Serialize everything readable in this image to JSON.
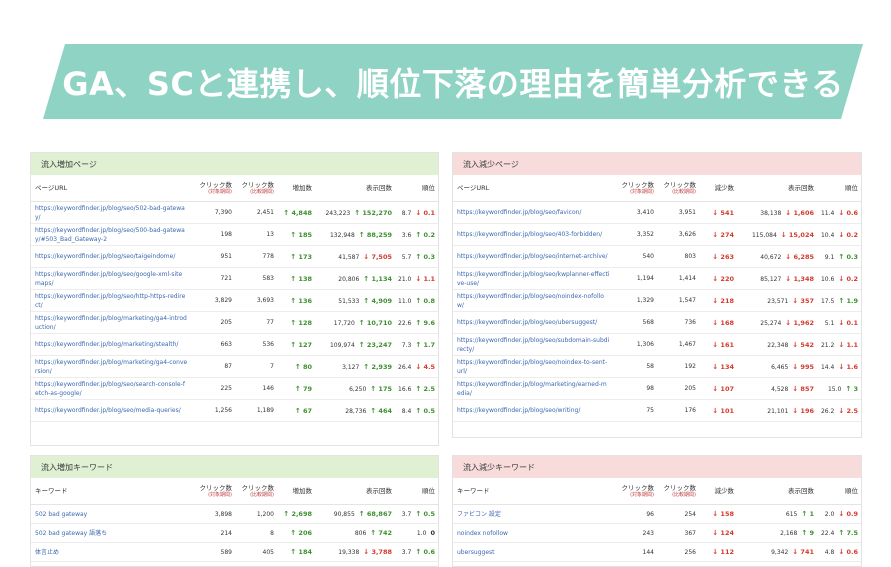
{
  "banner": {
    "title": "GA、SCと連携し、順位下落の理由を簡単分析できる",
    "color": "#8fd3c4"
  },
  "colors": {
    "up": "#3c8f2e",
    "down": "#d23a2e",
    "link": "#3b68b0"
  },
  "panels": {
    "increase_pages": {
      "title": "流入増加ページ",
      "headers": {
        "url": "ページURL",
        "click_curr": "クリック数",
        "click_curr_sub": "(対象期間)",
        "click_prev": "クリック数",
        "click_prev_sub": "(比較期間)",
        "delta": "増加数",
        "impr": "表示回数",
        "rank": "順位"
      },
      "rows": [
        {
          "url": "https://keywordfinder.jp/blog/seo/502-bad-gateway/",
          "c1": "7,390",
          "c2": "2,451",
          "d": "4,848",
          "dd": "up",
          "i": "243,223",
          "id": "152,270",
          "idd": "up",
          "r": "8.7",
          "rd": "0.1",
          "rdd": "down"
        },
        {
          "url": "https://keywordfinder.jp/blog/seo/500-bad-gateway/#503_Bad_Gateway-2",
          "c1": "198",
          "c2": "13",
          "d": "185",
          "dd": "up",
          "i": "132,948",
          "id": "88,259",
          "idd": "up",
          "r": "3.6",
          "rd": "0.2",
          "rdd": "up"
        },
        {
          "url": "https://keywordfinder.jp/blog/seo/taigeindome/",
          "c1": "951",
          "c2": "778",
          "d": "173",
          "dd": "up",
          "i": "41,587",
          "id": "7,505",
          "idd": "down",
          "r": "5.7",
          "rd": "0.3",
          "rdd": "up"
        },
        {
          "url": "https://keywordfinder.jp/blog/seo/google-xml-sitemaps/",
          "c1": "721",
          "c2": "583",
          "d": "138",
          "dd": "up",
          "i": "20,806",
          "id": "1,134",
          "idd": "up",
          "r": "21.0",
          "rd": "1.1",
          "rdd": "down"
        },
        {
          "url": "https://keywordfinder.jp/blog/seo/http-https-redirect/",
          "c1": "3,829",
          "c2": "3,693",
          "d": "136",
          "dd": "up",
          "i": "51,533",
          "id": "4,909",
          "idd": "up",
          "r": "11.0",
          "rd": "0.8",
          "rdd": "up"
        },
        {
          "url": "https://keywordfinder.jp/blog/marketing/ga4-introduction/",
          "c1": "205",
          "c2": "77",
          "d": "128",
          "dd": "up",
          "i": "17,720",
          "id": "10,710",
          "idd": "up",
          "r": "22.6",
          "rd": "9.6",
          "rdd": "up"
        },
        {
          "url": "https://keywordfinder.jp/blog/marketing/stealth/",
          "c1": "663",
          "c2": "536",
          "d": "127",
          "dd": "up",
          "i": "109,974",
          "id": "23,247",
          "idd": "up",
          "r": "7.3",
          "rd": "1.7",
          "rdd": "up"
        },
        {
          "url": "https://keywordfinder.jp/blog/marketing/ga4-conversion/",
          "c1": "87",
          "c2": "7",
          "d": "80",
          "dd": "up",
          "i": "3,127",
          "id": "2,939",
          "idd": "up",
          "r": "26.4",
          "rd": "4.5",
          "rdd": "down"
        },
        {
          "url": "https://keywordfinder.jp/blog/seo/search-console-fetch-as-google/",
          "c1": "225",
          "c2": "146",
          "d": "79",
          "dd": "up",
          "i": "6,250",
          "id": "175",
          "idd": "up",
          "r": "16.6",
          "rd": "2.5",
          "rdd": "up"
        },
        {
          "url": "https://keywordfinder.jp/blog/seo/media-queries/",
          "c1": "1,256",
          "c2": "1,189",
          "d": "67",
          "dd": "up",
          "i": "28,736",
          "id": "464",
          "idd": "up",
          "r": "8.4",
          "rd": "0.5",
          "rdd": "up"
        }
      ]
    },
    "decrease_pages": {
      "title": "流入減少ページ",
      "headers": {
        "url": "ページURL",
        "click_curr": "クリック数",
        "click_curr_sub": "(対象期間)",
        "click_prev": "クリック数",
        "click_prev_sub": "(比較期間)",
        "delta": "減少数",
        "impr": "表示回数",
        "rank": "順位"
      },
      "rows": [
        {
          "url": "https://keywordfinder.jp/blog/seo/favicon/",
          "c1": "3,410",
          "c2": "3,951",
          "d": "541",
          "dd": "down",
          "i": "38,138",
          "id": "1,606",
          "idd": "down",
          "r": "11.4",
          "rd": "0.6",
          "rdd": "down"
        },
        {
          "url": "https://keywordfinder.jp/blog/seo/403-forbidden/",
          "c1": "3,352",
          "c2": "3,626",
          "d": "274",
          "dd": "down",
          "i": "115,084",
          "id": "15,024",
          "idd": "down",
          "r": "10.4",
          "rd": "0.2",
          "rdd": "down"
        },
        {
          "url": "https://keywordfinder.jp/blog/seo/internet-archive/",
          "c1": "540",
          "c2": "803",
          "d": "263",
          "dd": "down",
          "i": "40,672",
          "id": "6,285",
          "idd": "down",
          "r": "9.1",
          "rd": "0.3",
          "rdd": "up"
        },
        {
          "url": "https://keywordfinder.jp/blog/seo/kwplanner-effective-use/",
          "c1": "1,194",
          "c2": "1,414",
          "d": "220",
          "dd": "down",
          "i": "85,127",
          "id": "1,348",
          "idd": "down",
          "r": "10.6",
          "rd": "0.2",
          "rdd": "down"
        },
        {
          "url": "https://keywordfinder.jp/blog/seo/noindex-nofollow/",
          "c1": "1,329",
          "c2": "1,547",
          "d": "218",
          "dd": "down",
          "i": "23,571",
          "id": "357",
          "idd": "down",
          "r": "17.5",
          "rd": "1.9",
          "rdd": "up"
        },
        {
          "url": "https://keywordfinder.jp/blog/seo/ubersuggest/",
          "c1": "568",
          "c2": "736",
          "d": "168",
          "dd": "down",
          "i": "25,274",
          "id": "1,962",
          "idd": "down",
          "r": "5.1",
          "rd": "0.1",
          "rdd": "down"
        },
        {
          "url": "https://keywordfinder.jp/blog/seo/subdomain-subdirecty/",
          "c1": "1,306",
          "c2": "1,467",
          "d": "161",
          "dd": "down",
          "i": "22,348",
          "id": "542",
          "idd": "down",
          "r": "21.2",
          "rd": "1.1",
          "rdd": "down"
        },
        {
          "url": "https://keywordfinder.jp/blog/seo/noindex-to-sent-url/",
          "c1": "58",
          "c2": "192",
          "d": "134",
          "dd": "down",
          "i": "6,465",
          "id": "995",
          "idd": "down",
          "r": "14.4",
          "rd": "1.6",
          "rdd": "down"
        },
        {
          "url": "https://keywordfinder.jp/blog/marketing/earned-media/",
          "c1": "98",
          "c2": "205",
          "d": "107",
          "dd": "down",
          "i": "4,528",
          "id": "857",
          "idd": "down",
          "r": "15.0",
          "rd": "3",
          "rdd": "up"
        },
        {
          "url": "https://keywordfinder.jp/blog/seo/writing/",
          "c1": "75",
          "c2": "176",
          "d": "101",
          "dd": "down",
          "i": "21,101",
          "id": "196",
          "idd": "down",
          "r": "26.2",
          "rd": "2.5",
          "rdd": "down"
        }
      ]
    },
    "increase_keywords": {
      "title": "流入増加キーワード",
      "headers": {
        "kw": "キーワード",
        "click_curr": "クリック数",
        "click_curr_sub": "(対象期間)",
        "click_prev": "クリック数",
        "click_prev_sub": "(比較期間)",
        "delta": "増加数",
        "impr": "表示回数",
        "rank": "順位"
      },
      "rows": [
        {
          "kw": "502 bad gateway",
          "c1": "3,898",
          "c2": "1,200",
          "d": "2,698",
          "dd": "up",
          "i": "90,855",
          "id": "68,867",
          "idd": "up",
          "r": "3.7",
          "rd": "0.5",
          "rdd": "up"
        },
        {
          "kw": "502 bad gateway 語落ち",
          "c1": "214",
          "c2": "8",
          "d": "206",
          "dd": "up",
          "i": "806",
          "id": "742",
          "idd": "up",
          "r": "1.0",
          "rd": "0",
          "rdd": "none"
        },
        {
          "kw": "体言止め",
          "c1": "589",
          "c2": "405",
          "d": "184",
          "dd": "up",
          "i": "19,338",
          "id": "3,788",
          "idd": "down",
          "r": "3.7",
          "rd": "0.6",
          "rdd": "up"
        }
      ]
    },
    "decrease_keywords": {
      "title": "流入減少キーワード",
      "headers": {
        "kw": "キーワード",
        "click_curr": "クリック数",
        "click_curr_sub": "(対象期間)",
        "click_prev": "クリック数",
        "click_prev_sub": "(比較期間)",
        "delta": "減少数",
        "impr": "表示回数",
        "rank": "順位"
      },
      "rows": [
        {
          "kw": "ファビコン 設定",
          "c1": "96",
          "c2": "254",
          "d": "158",
          "dd": "down",
          "i": "615",
          "id": "1",
          "idd": "up",
          "r": "2.0",
          "rd": "0.9",
          "rdd": "down"
        },
        {
          "kw": "noindex nofollow",
          "c1": "243",
          "c2": "367",
          "d": "124",
          "dd": "down",
          "i": "2,168",
          "id": "9",
          "idd": "up",
          "r": "22.4",
          "rd": "7.5",
          "rdd": "up"
        },
        {
          "kw": "ubersuggest",
          "c1": "144",
          "c2": "256",
          "d": "112",
          "dd": "down",
          "i": "9,342",
          "id": "741",
          "idd": "down",
          "r": "4.8",
          "rd": "0.6",
          "rdd": "down"
        }
      ]
    }
  }
}
